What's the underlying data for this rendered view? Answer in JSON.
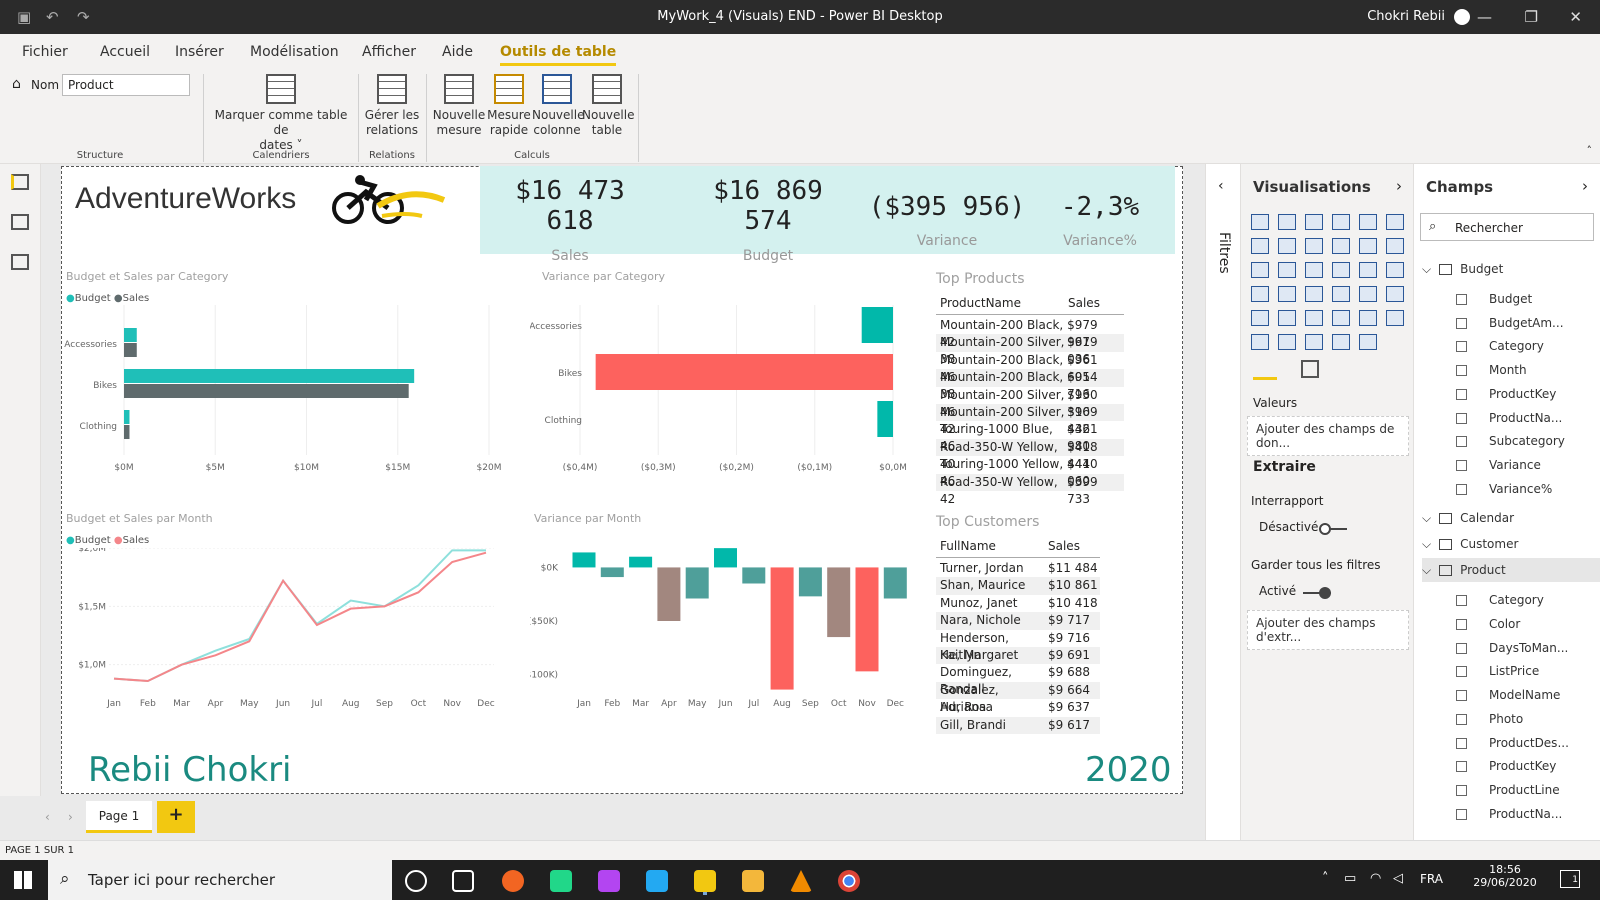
{
  "window": {
    "title": "MyWork_4 (Visuals) END - Power BI Desktop",
    "user": "Chokri Rebii"
  },
  "menu": [
    "Fichier",
    "Accueil",
    "Insérer",
    "Modélisation",
    "Afficher",
    "Aide",
    "Outils de table"
  ],
  "ribbon": {
    "name_label": "Nom",
    "name_value": "Product",
    "mark_date_l1": "Marquer comme table de",
    "mark_date_l2": "dates",
    "relations_l1": "Gérer les",
    "relations_l2": "relations",
    "new_measure_l1": "Nouvelle",
    "new_measure_l2": "mesure",
    "quick_measure_l1": "Mesure",
    "quick_measure_l2": "rapide",
    "new_column_l1": "Nouvelle",
    "new_column_l2": "colonne",
    "new_table_l1": "Nouvelle",
    "new_table_l2": "table",
    "groups": {
      "structure": "Structure",
      "calendars": "Calendriers",
      "relations": "Relations",
      "calculs": "Calculs"
    }
  },
  "report": {
    "brand": "AdventureWorks",
    "kpis": [
      {
        "v1": "$16 473",
        "v2": "618",
        "label": "Sales"
      },
      {
        "v1": "$16 869",
        "v2": "574",
        "label": "Budget"
      },
      {
        "v1": "($395 956)",
        "label": "Variance"
      },
      {
        "v1": "-2,3%",
        "label": "Variance%"
      }
    ],
    "footer_name": "Rebii Chokri",
    "footer_year": "2020",
    "colors": {
      "budget": "#1fbfb8",
      "sales_bar": "#5f6b6d",
      "sales_line": "#f4868a",
      "neg": "#fd625e",
      "teal": "#01b8aa"
    }
  },
  "chart_data": [
    {
      "type": "bar",
      "title": "Budget et Sales par Category",
      "legend": [
        "Budget",
        "Sales"
      ],
      "categories": [
        "Accessories",
        "Bikes",
        "Clothing"
      ],
      "series": [
        {
          "name": "Budget",
          "values": [
            0.7,
            15.9,
            0.3
          ]
        },
        {
          "name": "Sales",
          "values": [
            0.7,
            15.6,
            0.3
          ]
        }
      ],
      "xticks": [
        "$0M",
        "$5M",
        "$10M",
        "$15M",
        "$20M"
      ],
      "xlim": [
        0,
        20
      ]
    },
    {
      "type": "bar",
      "title": "Variance par Category",
      "categories": [
        "Accessories",
        "Bikes",
        "Clothing"
      ],
      "values": [
        0.04,
        -0.38,
        0.02
      ],
      "xticks": [
        "($0,4M)",
        "($0,3M)",
        "($0,2M)",
        "($0,1M)",
        "$0,0M"
      ],
      "xlim": [
        -0.4,
        0
      ]
    },
    {
      "type": "line",
      "title": "Budget et Sales par Month",
      "legend": [
        "Budget",
        "Sales"
      ],
      "x": [
        "Jan",
        "Feb",
        "Mar",
        "Apr",
        "May",
        "Jun",
        "Jul",
        "Aug",
        "Sep",
        "Oct",
        "Nov",
        "Dec"
      ],
      "series": [
        {
          "name": "Budget",
          "values": [
            0.88,
            0.86,
            1.0,
            1.12,
            1.22,
            1.72,
            1.35,
            1.55,
            1.5,
            1.68,
            1.98,
            1.98
          ]
        },
        {
          "name": "Sales",
          "values": [
            0.88,
            0.86,
            1.0,
            1.08,
            1.2,
            1.72,
            1.34,
            1.48,
            1.5,
            1.62,
            1.88,
            1.96
          ]
        }
      ],
      "yticks": [
        "$2,0M",
        "$1,5M",
        "$1,0M"
      ],
      "ylim": [
        0.8,
        2.0
      ]
    },
    {
      "type": "bar",
      "title": "Variance par Month",
      "x": [
        "Jan",
        "Feb",
        "Mar",
        "Apr",
        "May",
        "Jun",
        "Jul",
        "Aug",
        "Sep",
        "Oct",
        "Nov",
        "Dec"
      ],
      "values": [
        14,
        -9,
        10,
        -50,
        -29,
        18,
        -15,
        -114,
        -27,
        -65,
        -97,
        -29
      ],
      "yticks": [
        "$0K",
        "($50K)",
        "($100K)"
      ],
      "ylim": [
        -120,
        20
      ]
    }
  ],
  "top_products": {
    "title": "Top Products",
    "headers": [
      "ProductName",
      "Sales"
    ],
    "rows": [
      [
        "Mountain-200 Black, 42",
        "$979 961"
      ],
      [
        "Mountain-200 Silver, 38",
        "$979 036"
      ],
      [
        "Mountain-200 Black, 46",
        "$961 601"
      ],
      [
        "Mountain-200 Black, 38",
        "$954 716"
      ],
      [
        "Mountain-200 Silver, 46",
        "$930 316"
      ],
      [
        "Mountain-200 Silver, 42",
        "$909 436"
      ],
      [
        "Touring-1000 Blue, 46",
        "$421 980"
      ],
      [
        "Road-350-W Yellow, 40",
        "$418 444"
      ],
      [
        "Touring-1000 Yellow, 46",
        "$410 060"
      ],
      [
        "Road-350-W Yellow, 42",
        "$399 733"
      ]
    ]
  },
  "top_customers": {
    "title": "Top Customers",
    "headers": [
      "FullName",
      "Sales"
    ],
    "rows": [
      [
        "Turner, Jordan",
        "$11 484"
      ],
      [
        "Shan, Maurice",
        "$10 861"
      ],
      [
        "Munoz, Janet",
        "$10 418"
      ],
      [
        "Nara, Nichole",
        "$9 717"
      ],
      [
        "Henderson, Kaitlyn",
        "$9 716"
      ],
      [
        "He, Margaret",
        "$9 691"
      ],
      [
        "Dominguez, Randall",
        "$9 688"
      ],
      [
        "Gonzalez, Adriana",
        "$9 664"
      ],
      [
        "Hu, Rosa",
        "$9 637"
      ],
      [
        "Gill, Brandi",
        "$9 617"
      ]
    ]
  },
  "filters_label": "Filtres",
  "viz": {
    "title": "Visualisations",
    "values_label": "Valeurs",
    "values_placeholder": "Ajouter des champs de don...",
    "extract": "Extraire",
    "cross_report": "Interrapport",
    "cross_state": "Désactivé",
    "keep_filters": "Garder tous les filtres",
    "keep_state": "Activé",
    "drill_placeholder": "Ajouter des champs d'extr..."
  },
  "fields": {
    "title": "Champs",
    "search_placeholder": "Rechercher",
    "tables": [
      {
        "name": "Budget",
        "items": [
          "Budget",
          "BudgetAm...",
          "Category",
          "Month",
          "ProductKey",
          "ProductNa...",
          "Subcategory",
          "Variance",
          "Variance%"
        ]
      },
      {
        "name": "Calendar"
      },
      {
        "name": "Customer"
      },
      {
        "name": "Product",
        "items": [
          "Category",
          "Color",
          "DaysToMan...",
          "ListPrice",
          "ModelName",
          "Photo",
          "ProductDes...",
          "ProductKey",
          "ProductLine",
          "ProductNa..."
        ]
      }
    ]
  },
  "pages": {
    "tab": "Page 1",
    "status": "PAGE 1 SUR 1"
  },
  "taskbar": {
    "search": "Taper ici pour rechercher",
    "lang": "FRA",
    "time": "18:56",
    "date": "29/06/2020",
    "notif": "1"
  }
}
